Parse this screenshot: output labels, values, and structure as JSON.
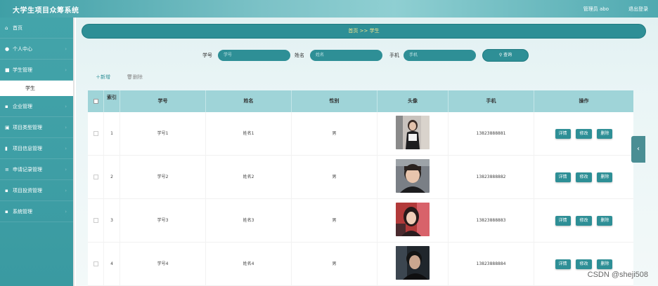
{
  "app": {
    "title": "大学生项目众筹系统",
    "user_label": "管理员 abo",
    "logout_label": "退出登录"
  },
  "sidebar": {
    "items": [
      {
        "label": "首页",
        "icon": "home-icon"
      },
      {
        "label": "个人中心",
        "icon": "user-icon"
      },
      {
        "label": "学生管理",
        "icon": "list-icon"
      },
      {
        "label": "企业管理",
        "icon": "grid-icon"
      },
      {
        "label": "项目类型管理",
        "icon": "folder-icon"
      },
      {
        "label": "项目信息管理",
        "icon": "bar-chart-icon"
      },
      {
        "label": "申请记录管理",
        "icon": "menu-icon"
      },
      {
        "label": "项目投资管理",
        "icon": "grid-icon"
      },
      {
        "label": "系统管理",
        "icon": "grid-icon"
      }
    ],
    "active_sub": "学生"
  },
  "breadcrumb": "首页 >> 学生",
  "search": {
    "student_id_label": "学号",
    "student_id_placeholder": "学号",
    "name_label": "姓名",
    "name_placeholder": "姓名",
    "phone_label": "手机",
    "phone_placeholder": "手机",
    "query_button": "查询"
  },
  "actions": {
    "add": "新增",
    "delete": "删除"
  },
  "table": {
    "headers": [
      "",
      "索引",
      "学号",
      "姓名",
      "性别",
      "头像",
      "手机",
      "操作"
    ],
    "rows": [
      {
        "index": "1",
        "student_id": "学号1",
        "name": "姓名1",
        "gender": "男",
        "phone": "13823888881"
      },
      {
        "index": "2",
        "student_id": "学号2",
        "name": "姓名2",
        "gender": "男",
        "phone": "13823888882"
      },
      {
        "index": "3",
        "student_id": "学号3",
        "name": "姓名3",
        "gender": "男",
        "phone": "13823888883"
      },
      {
        "index": "4",
        "student_id": "学号4",
        "name": "姓名4",
        "gender": "男",
        "phone": "13823888884"
      }
    ],
    "op_labels": [
      "详情",
      "修改",
      "删除"
    ]
  },
  "watermark": "CSDN @sheji508",
  "colors": {
    "teal": "#2e8f96",
    "header_teal": "#9fd4d8",
    "breadcrumb_text": "#f6e58d"
  }
}
